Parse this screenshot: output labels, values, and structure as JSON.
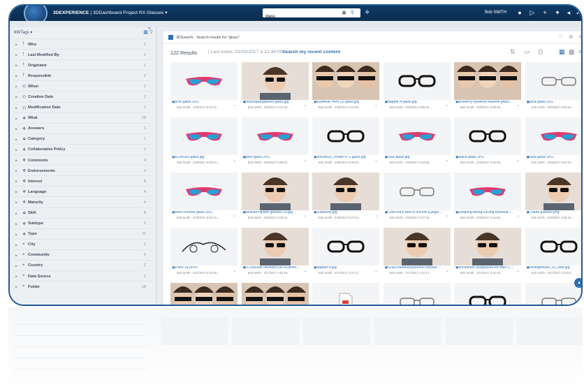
{
  "header": {
    "brand": "3DEXPERIENCE",
    "separator": " | ",
    "dashboard": "3DDashboard Project RX Glasses",
    "search_value": "glass",
    "user": "Bob SMITH"
  },
  "sidebar": {
    "title": "6WTags",
    "facets": [
      {
        "label": "Who",
        "count": "2",
        "icon": "tag-icon"
      },
      {
        "label": "Last Modified By",
        "count": "2",
        "icon": "tag-icon"
      },
      {
        "label": "Originator",
        "count": "1",
        "icon": "tag-icon"
      },
      {
        "label": "Responsible",
        "count": "2",
        "icon": "tag-icon"
      },
      {
        "label": "When",
        "count": "2",
        "icon": "clock-icon"
      },
      {
        "label": "Creation Date",
        "count": "1",
        "icon": "clock-icon"
      },
      {
        "label": "Modification Date",
        "count": "1",
        "icon": "clock-icon"
      },
      {
        "label": "What",
        "count": "18",
        "icon": "cube-icon"
      },
      {
        "label": "Answers",
        "count": "1",
        "icon": "cube-icon"
      },
      {
        "label": "Category",
        "count": "1",
        "icon": "cube-icon"
      },
      {
        "label": "Collaborative Policy",
        "count": "2",
        "icon": "cube-icon"
      },
      {
        "label": "Comments",
        "count": "4",
        "icon": "cube-icon"
      },
      {
        "label": "Endorsements",
        "count": "4",
        "icon": "cube-icon"
      },
      {
        "label": "Interest",
        "count": "8",
        "icon": "cube-icon"
      },
      {
        "label": "Language",
        "count": "4",
        "icon": "cube-icon"
      },
      {
        "label": "Maturity",
        "count": "4",
        "icon": "cube-icon"
      },
      {
        "label": "Skill",
        "count": "8",
        "icon": "cube-icon"
      },
      {
        "label": "Subtype",
        "count": "2",
        "icon": "cube-icon"
      },
      {
        "label": "Type",
        "count": "11",
        "icon": "cube-icon"
      },
      {
        "label": "City",
        "count": "1",
        "icon": "pin-icon"
      },
      {
        "label": "Community",
        "count": "6",
        "icon": "pin-icon"
      },
      {
        "label": "Country",
        "count": "1",
        "icon": "pin-icon"
      },
      {
        "label": "Data Source",
        "count": "1",
        "icon": "pin-icon"
      },
      {
        "label": "Folder",
        "count": "18",
        "icon": "pin-icon"
      }
    ]
  },
  "panel": {
    "title": "3DSearch - Search results for \"glass\"",
    "results_count": "122  Results",
    "last_index": "Last index: 01/03/2017 à 12:44:00",
    "recent_link": "Search my recent content"
  },
  "tiles": [
    {
      "name": "scor-glass.JPG",
      "meta": "Bob Smith - 2/28/2017 6:10:42...",
      "kind": "sport"
    },
    {
      "name": "dolchabbyglasses-glass.jpg",
      "meta": "Bob Smith - 2/28/2017 6:10:20...",
      "kind": "face"
    },
    {
      "name": "Eyewear Hero 02-glass.jpg",
      "meta": "Bob Smith - 2/28/2017 6:10:06...",
      "kind": "faces"
    },
    {
      "name": "dapper-4-glass.jpg",
      "meta": "Bob Smith - 2/28/2017 6:09:44...",
      "kind": "black"
    },
    {
      "name": "Burberry-eyewear-Autumn-glass.jpg",
      "meta": "Bob Smith - 2/28/2017 6:09:35...",
      "kind": "faces"
    },
    {
      "name": "plus-glass.JPG",
      "meta": "Bob Smith - 2/28/2017 6:09:15...",
      "kind": "clear"
    },
    {
      "name": "R154009-glass.jpg",
      "meta": "Bob Smith - 2/28/2017 6:09:04...",
      "kind": "sport"
    },
    {
      "name": "pink-glass.JPG",
      "meta": "Bob Smith - 2/28/2017 6:08:57...",
      "kind": "sport"
    },
    {
      "name": "NIKIB520_Profile-471-glass.jpg",
      "meta": "Bob Smith - 2/28/2017 6:08:40...",
      "kind": "black"
    },
    {
      "name": "f5ee-glass.jpg",
      "meta": "Bob Smith - 2/28/2017 6:02:53...",
      "kind": "sport"
    },
    {
      "name": "black-glass.JPG",
      "meta": "Bob Smith - 2/28/2017 6:02:29...",
      "kind": "black"
    },
    {
      "name": "blue-glass.JPG",
      "meta": "Bob Smith - 2/28/2017 6:02:16...",
      "kind": "sport"
    },
    {
      "name": "retro-chrome-glass.JPG",
      "meta": "Bob Smith - 2/28/2017 6:02:10...",
      "kind": "sport"
    },
    {
      "name": "woman-hipster-glasses-16.jpg",
      "meta": "Bob Smith - 2/28/2017 5:28:10...",
      "kind": "face"
    },
    {
      "name": "Glasses8.jpg",
      "meta": "Bob Smith - 2/28/2017 5:27:54...",
      "kind": "face"
    },
    {
      "name": "Cool-hot-k-Men-k-hot-fire-Eyeglasses-k-hot-fire-Frame.jpg",
      "meta": "Bob Smith - 2/28/2017 5:27:33...",
      "kind": "clear"
    },
    {
      "name": "camping-hiking-cycling-eyewear-sport-glasses.jpg",
      "meta": "Bob Smith - 2/28/2017 5:24:58...",
      "kind": "sport"
    },
    {
      "name": "74dd4-glasses.png",
      "meta": "Bob Smith - 2/28/2017 3:58:40...",
      "kind": "face"
    },
    {
      "name": "Part2-SLDPRT",
      "meta": "Bob Smith - 2/27/2017 5:20:38...",
      "kind": "wire"
    },
    {
      "name": "0.23d33a87b6f4d8f15b7e2a6f45a.jpg",
      "meta": "Bob Smith - 2/27/2017 4:51:18...",
      "kind": "face"
    },
    {
      "name": "dapper-4.jpg",
      "meta": "Bob Smith - 2/27/2017 4:37:17...",
      "kind": "black"
    },
    {
      "name": "52a2c9a4b6e5a3b6f4a7f6d8ab76ee.jpg",
      "meta": "Bob Smith - 2/27/2017 4:37:17...",
      "kind": "face"
    },
    {
      "name": "IHFashion-sunglasses-for-Men-1.jpg",
      "meta": "Bob Smith - 2/27/2017 4:51:18...",
      "kind": "face"
    },
    {
      "name": "woodglasses_02_web.jpg",
      "meta": "Bob Smith - 2/27/2017 12:04:2...",
      "kind": "black"
    }
  ],
  "partial_tiles": [
    "faces",
    "faces",
    "doc",
    "clear",
    "black",
    "clear"
  ],
  "colors": {
    "accent": "#2f6fb1",
    "topbar": "#0f3a66",
    "frame": "#1f5a99"
  }
}
